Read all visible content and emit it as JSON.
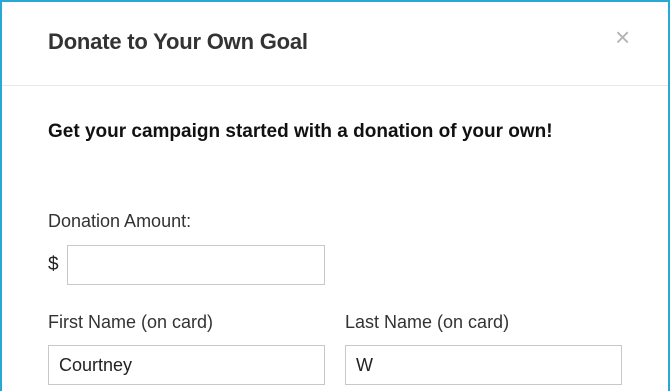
{
  "dialog": {
    "title": "Donate to Your Own Goal",
    "close_glyph": "×",
    "close_icon": "close-icon"
  },
  "intro": {
    "text": "Get your campaign started with a donation of your own!"
  },
  "form": {
    "amount_label": "Donation Amount:",
    "currency_symbol": "$",
    "amount_value": "",
    "first_name_label": "First Name (on card)",
    "first_name_value": "Courtney",
    "last_name_label": "Last Name (on card)",
    "last_name_value": "W"
  },
  "colors": {
    "accent_border": "#29a8d4",
    "field_border": "#c8c8c8"
  }
}
